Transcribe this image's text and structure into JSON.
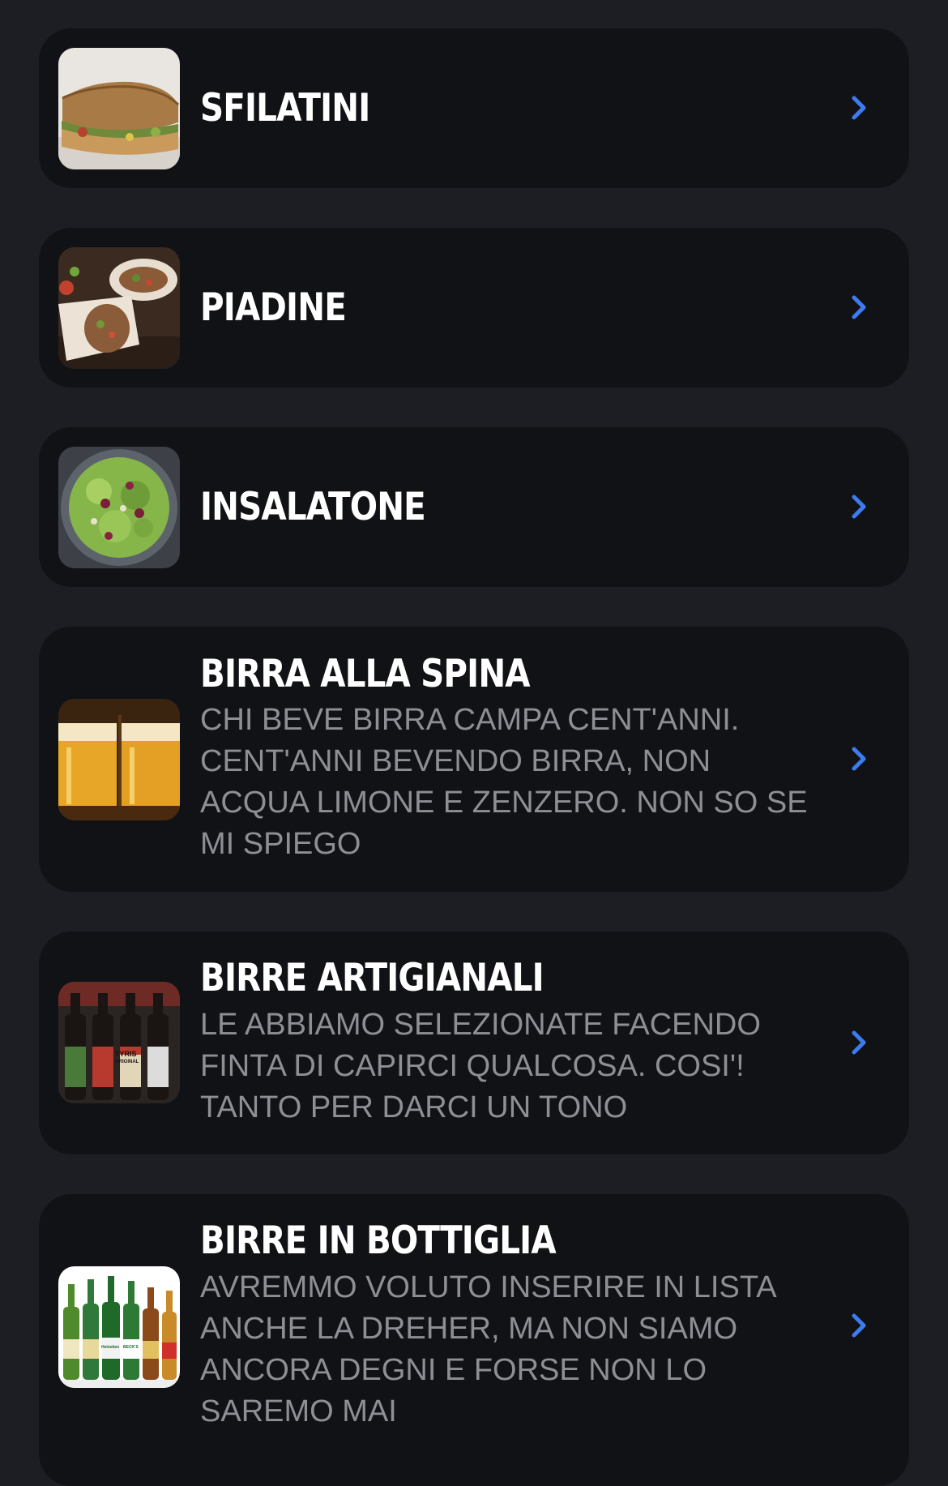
{
  "menu": {
    "categories": [
      {
        "title": "SFILATINI",
        "description": "",
        "thumbnail": "sandwich-photo"
      },
      {
        "title": "PIADINE",
        "description": "",
        "thumbnail": "wrap-photo"
      },
      {
        "title": "INSALATONE",
        "description": "",
        "thumbnail": "salad-photo"
      },
      {
        "title": "BIRRA ALLA SPINA",
        "description": "CHI BEVE BIRRA CAMPA CENT'ANNI. CENT'ANNI BEVENDO BIRRA, NON ACQUA LIMONE E ZENZERO. NON SO SE MI SPIEGO",
        "thumbnail": "draft-beer-photo"
      },
      {
        "title": "BIRRE ARTIGIANALI",
        "description": "LE ABBIAMO SELEZIONATE FACENDO FINTA DI CAPIRCI QUALCOSA. COSI'! TANTO PER DARCI UN TONO",
        "thumbnail": "craft-beer-photo"
      },
      {
        "title": "BIRRE IN BOTTIGLIA",
        "description": "AVREMMO VOLUTO INSERIRE IN LISTA ANCHE LA DREHER, MA NON SIAMO ANCORA DEGNI E FORSE NON LO SAREMO MAI",
        "thumbnail": "bottled-beer-photo"
      }
    ],
    "bottle_labels": [
      "TYRIS",
      "ORIGINAL",
      "Heineken",
      "BECK'S"
    ]
  },
  "colors": {
    "background": "#1c1e24",
    "card": "#111216",
    "title": "#ffffff",
    "description": "#8e8f95",
    "chevron": "#3d7bf0"
  },
  "icons": {
    "chevron": "chevron-right-icon"
  }
}
